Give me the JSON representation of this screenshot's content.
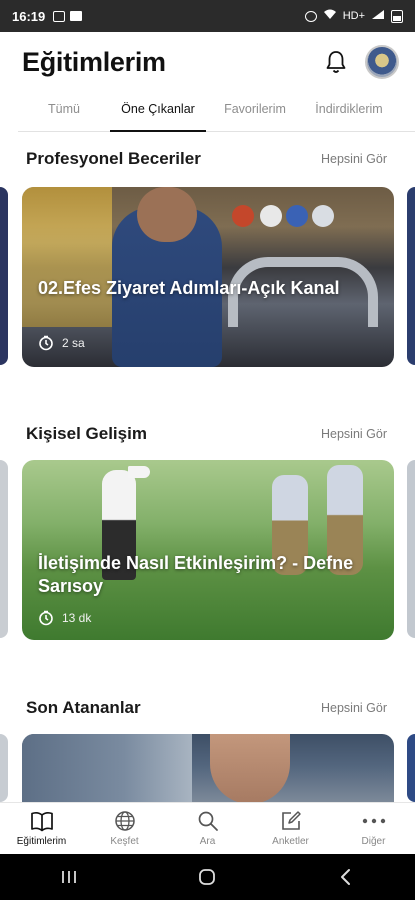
{
  "status_bar": {
    "time": "16:19",
    "network": "HD+"
  },
  "header": {
    "title": "Eğitimlerim"
  },
  "tabs": [
    {
      "label": "Tümü"
    },
    {
      "label": "Öne Çıkanlar"
    },
    {
      "label": "Favorilerim"
    },
    {
      "label": "İndirdiklerim"
    }
  ],
  "sections": [
    {
      "title": "Profesyonel Beceriler",
      "see_all": "Hepsini Gör",
      "card": {
        "title": "02.Efes Ziyaret Adımları-Açık Kanal",
        "duration": "2 sa"
      }
    },
    {
      "title": "Kişisel Gelişim",
      "see_all": "Hepsini Gör",
      "card": {
        "title": "İletişimde Nasıl Etkinleşirim? - Defne Sarısoy",
        "duration": "13 dk"
      }
    },
    {
      "title": "Son Atananlar",
      "see_all": "Hepsini Gör"
    }
  ],
  "bottom_nav": [
    {
      "label": "Eğitimlerim",
      "icon": "book-icon"
    },
    {
      "label": "Keşfet",
      "icon": "globe-icon"
    },
    {
      "label": "Ara",
      "icon": "search-icon"
    },
    {
      "label": "Anketler",
      "icon": "edit-icon"
    },
    {
      "label": "Diğer",
      "icon": "more-icon"
    }
  ],
  "colors": {
    "accent": "#111111",
    "muted": "#8e8e8e",
    "status_bar": "#2b2b2b"
  }
}
